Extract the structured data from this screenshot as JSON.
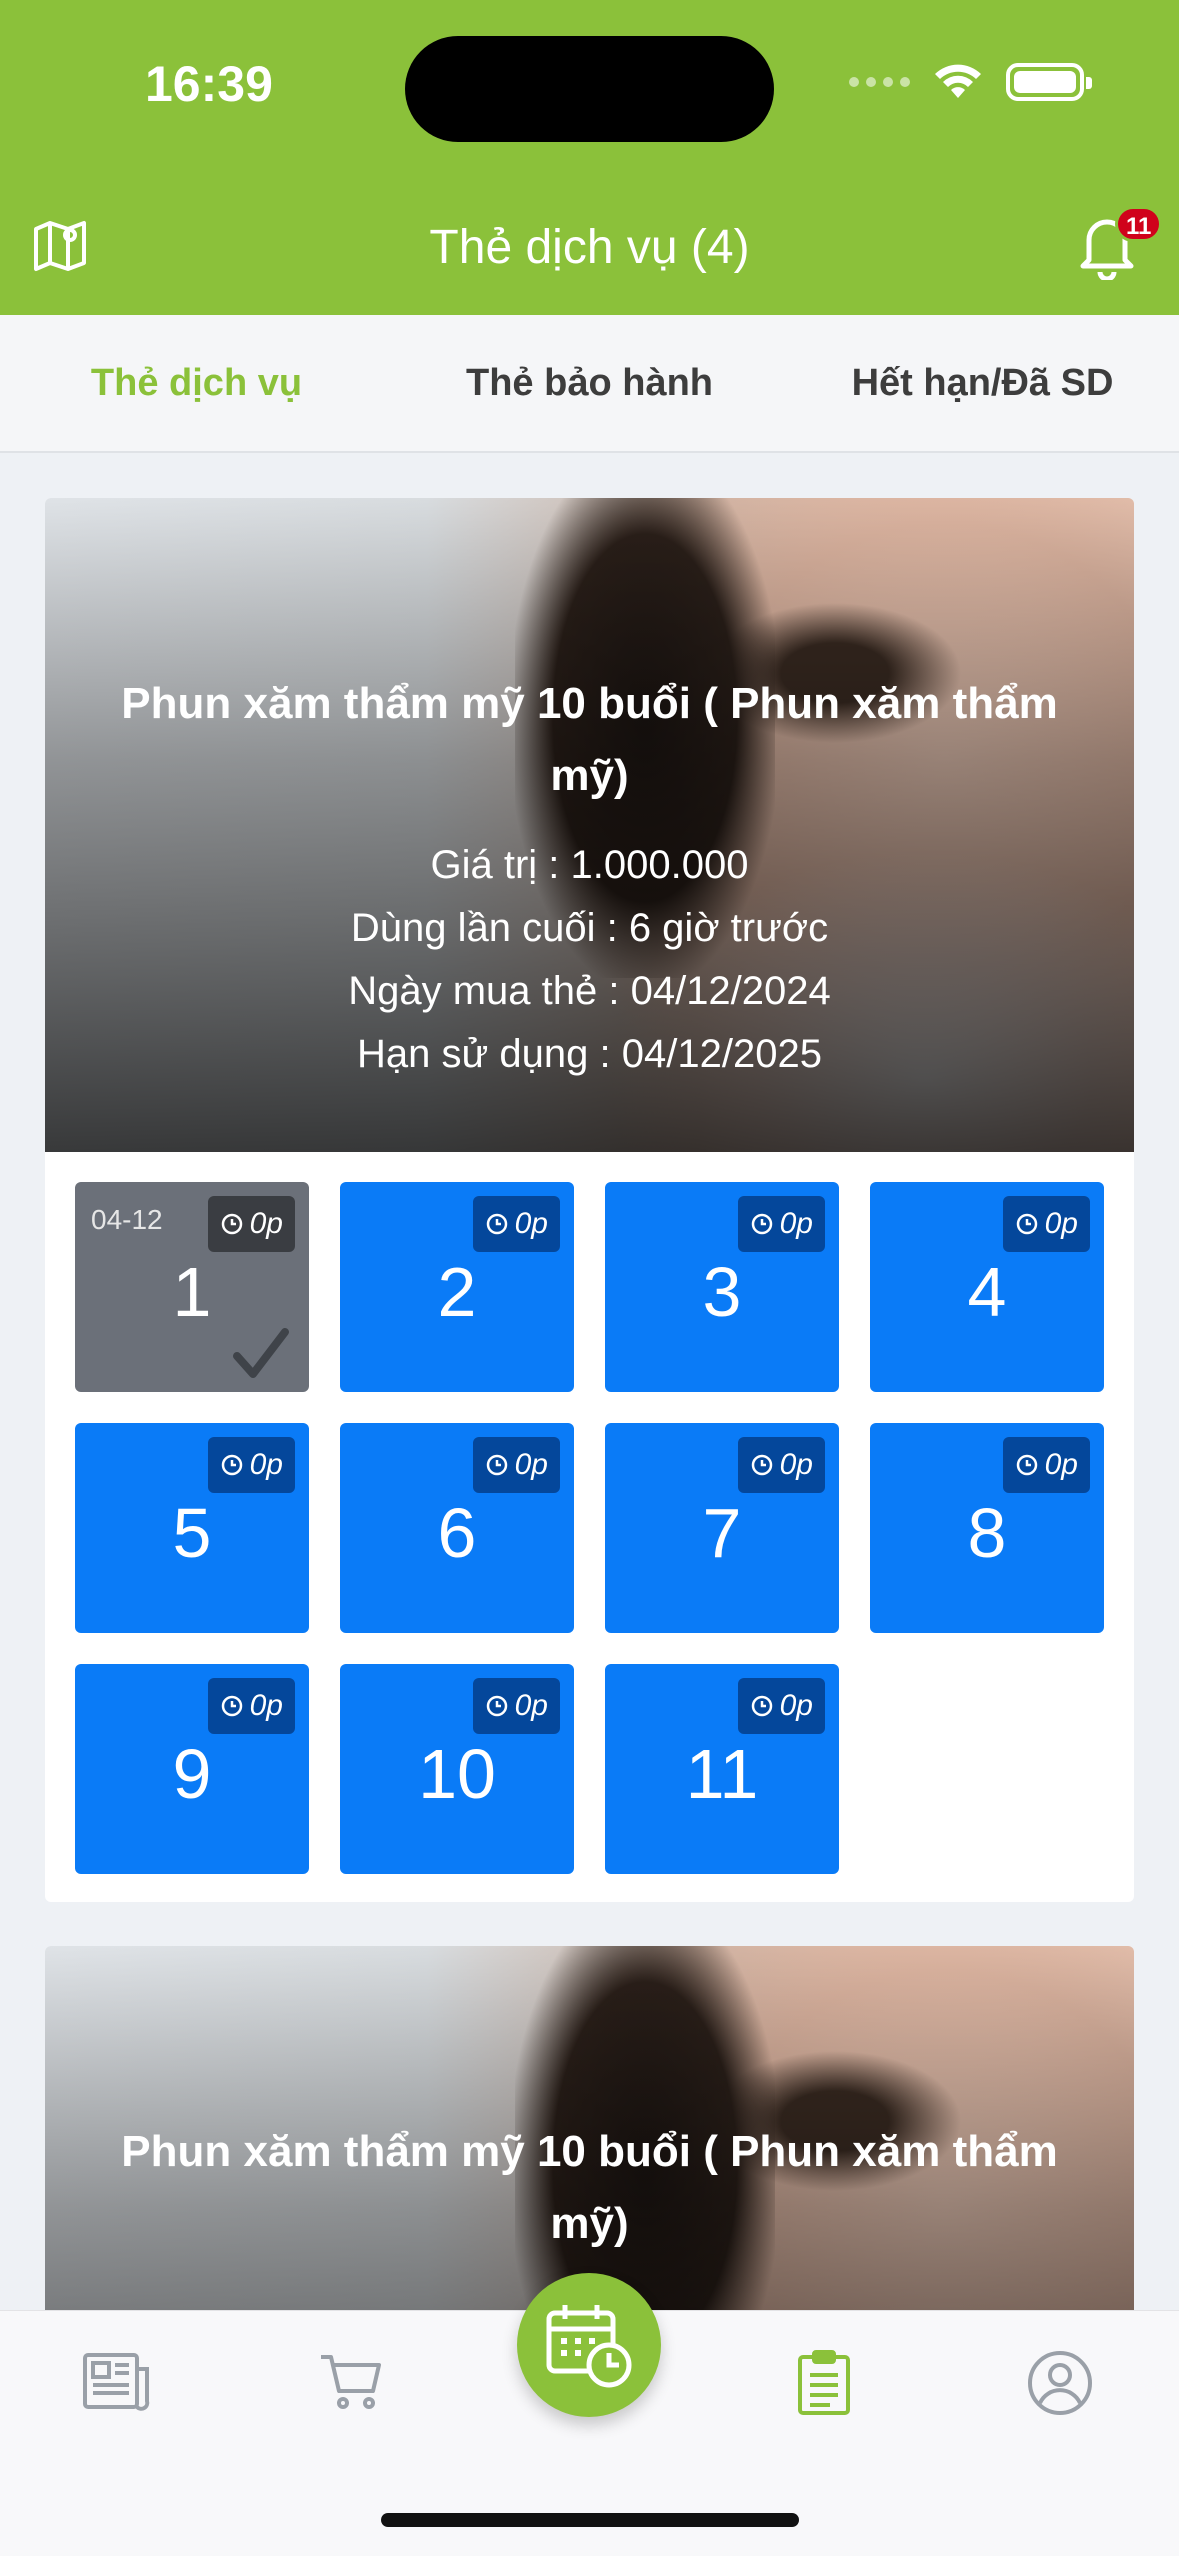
{
  "status_bar": {
    "time": "16:39"
  },
  "header": {
    "title": "Thẻ dịch vụ (4)",
    "notification_count": "11"
  },
  "tabs": [
    {
      "label": "Thẻ dịch vụ",
      "active": true
    },
    {
      "label": "Thẻ bảo hành",
      "active": false
    },
    {
      "label": "Hết hạn/Đã SD",
      "active": false
    }
  ],
  "cards": [
    {
      "title": "Phun xăm thẩm mỹ 10 buổi ( Phun xăm thẩm mỹ)",
      "value_line": "Giá trị : 1.000.000",
      "last_used_line": "Dùng lần cuối : 6 giờ trước",
      "purchase_line": "Ngày mua thẻ : 04/12/2024",
      "expiry_line": "Hạn sử dụng : 04/12/2025",
      "sessions": [
        {
          "number": "1",
          "duration": "0p",
          "date": "04-12",
          "used": true
        },
        {
          "number": "2",
          "duration": "0p"
        },
        {
          "number": "3",
          "duration": "0p"
        },
        {
          "number": "4",
          "duration": "0p"
        },
        {
          "number": "5",
          "duration": "0p"
        },
        {
          "number": "6",
          "duration": "0p"
        },
        {
          "number": "7",
          "duration": "0p"
        },
        {
          "number": "8",
          "duration": "0p"
        },
        {
          "number": "9",
          "duration": "0p"
        },
        {
          "number": "10",
          "duration": "0p"
        },
        {
          "number": "11",
          "duration": "0p"
        }
      ]
    },
    {
      "title": "Phun xăm thẩm mỹ 10 buổi ( Phun xăm thẩm mỹ)"
    }
  ],
  "bottom_nav": {
    "items": [
      "news-icon",
      "cart-icon",
      "booking-calendar-icon",
      "clipboard-icon",
      "profile-icon"
    ],
    "active": "clipboard-icon"
  },
  "colors": {
    "primary": "#8bc13a",
    "session_blue": "#0a7bf7",
    "session_used": "#6b7079",
    "badge_red": "#d0021b"
  }
}
